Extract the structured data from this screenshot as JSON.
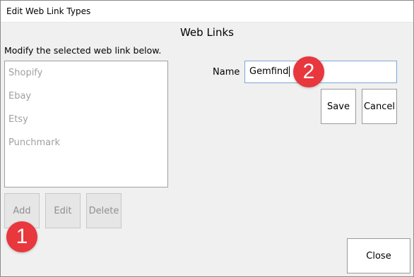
{
  "window": {
    "title": "Edit Web Link Types"
  },
  "header": {
    "label": "Web Links"
  },
  "instruction": "Modify the selected web link below.",
  "list": {
    "items": [
      "Shopify",
      "Ebay",
      "Etsy",
      "Punchmark"
    ]
  },
  "list_buttons": {
    "add": "Add",
    "edit": "Edit",
    "delete": "Delete"
  },
  "form": {
    "name_label": "Name",
    "name_value": "Gemfind",
    "save": "Save",
    "cancel": "Cancel"
  },
  "footer": {
    "close": "Close"
  },
  "callouts": {
    "one": "1",
    "two": "2"
  },
  "colors": {
    "callout": "#e8373d",
    "input_border": "#7aa7d8",
    "disabled_text": "#a0a0a0"
  }
}
